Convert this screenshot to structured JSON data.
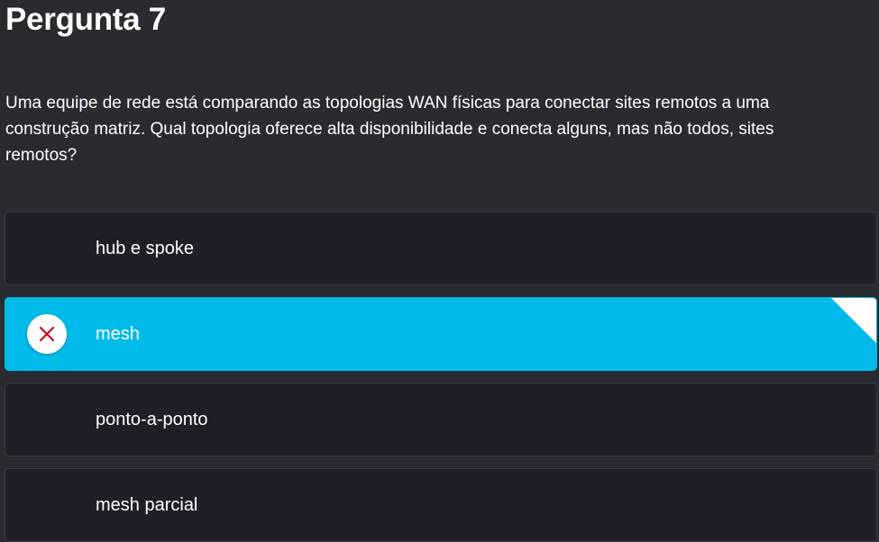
{
  "title": "Pergunta 7",
  "question": "Uma equipe de rede está comparando as topologias WAN físicas para conectar sites remotos a uma construção matriz. Qual topologia oferece alta disponibilidade e conecta alguns, mas não todos, sites remotos?",
  "options": [
    {
      "label": "hub e spoke",
      "selected": false
    },
    {
      "label": "mesh",
      "selected": true,
      "status": "incorrect",
      "icon": "close-icon"
    },
    {
      "label": "ponto-a-ponto",
      "selected": false
    },
    {
      "label": "mesh parcial",
      "selected": false
    }
  ],
  "colors": {
    "background": "#292b30",
    "option_bg": "#1f2027",
    "selected_bg": "#00bbea",
    "incorrect_mark": "#d0021b"
  }
}
